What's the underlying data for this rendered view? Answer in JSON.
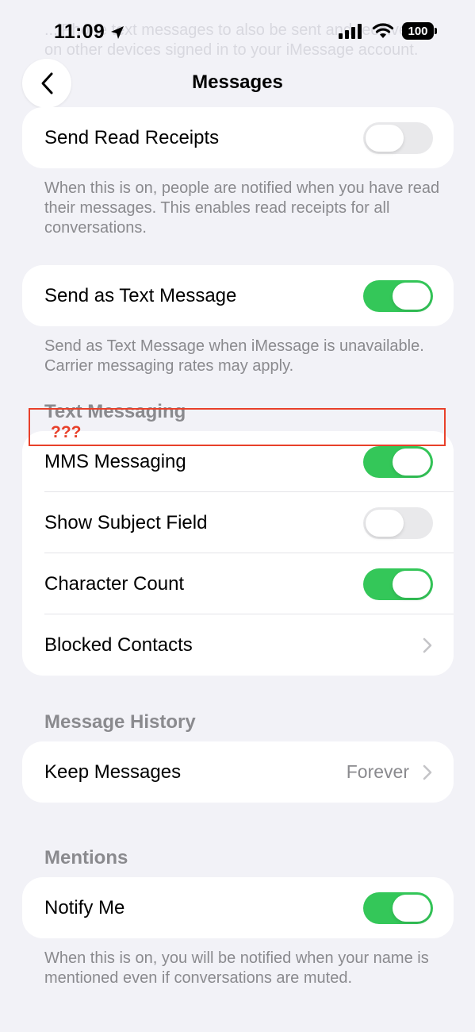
{
  "background_text": "...iPhone text messages to also be sent and received on other devices signed in to your iMessage account.",
  "status_bar": {
    "time": "11:09",
    "battery": "100",
    "icons": [
      "location-arrow-icon",
      "cellular-signal-icon",
      "wifi-icon",
      "battery-icon"
    ]
  },
  "nav": {
    "title": "Messages",
    "back_icon": "chevron-left-icon"
  },
  "read_receipts": {
    "label": "Send Read Receipts",
    "on": false,
    "footnote": "When this is on, people are notified when you have read their messages. This enables read receipts for all conversations."
  },
  "send_as_sms": {
    "label": "Send as Text Message",
    "on": true,
    "footnote": "Send as Text Message when iMessage is unavailable. Carrier messaging rates may apply."
  },
  "text_messaging": {
    "header": "Text Messaging",
    "rows": [
      {
        "label": "MMS Messaging",
        "on": true
      },
      {
        "label": "Show Subject Field",
        "on": false
      },
      {
        "label": "Character Count",
        "on": true
      },
      {
        "label": "Blocked Contacts"
      }
    ]
  },
  "message_history": {
    "header": "Message History",
    "keep_label": "Keep Messages",
    "keep_value": "Forever"
  },
  "mentions": {
    "header": "Mentions",
    "label": "Notify Me",
    "on": true,
    "footnote": "When this is on, you will be notified when your name is mentioned even if conversations are muted."
  },
  "annotation": {
    "label": "???",
    "color": "#e8402a"
  },
  "colors": {
    "toggle_on": "#34c759",
    "toggle_off": "#e9e9eb",
    "background": "#f2f2f7",
    "secondary_text": "#8a8a8e"
  }
}
